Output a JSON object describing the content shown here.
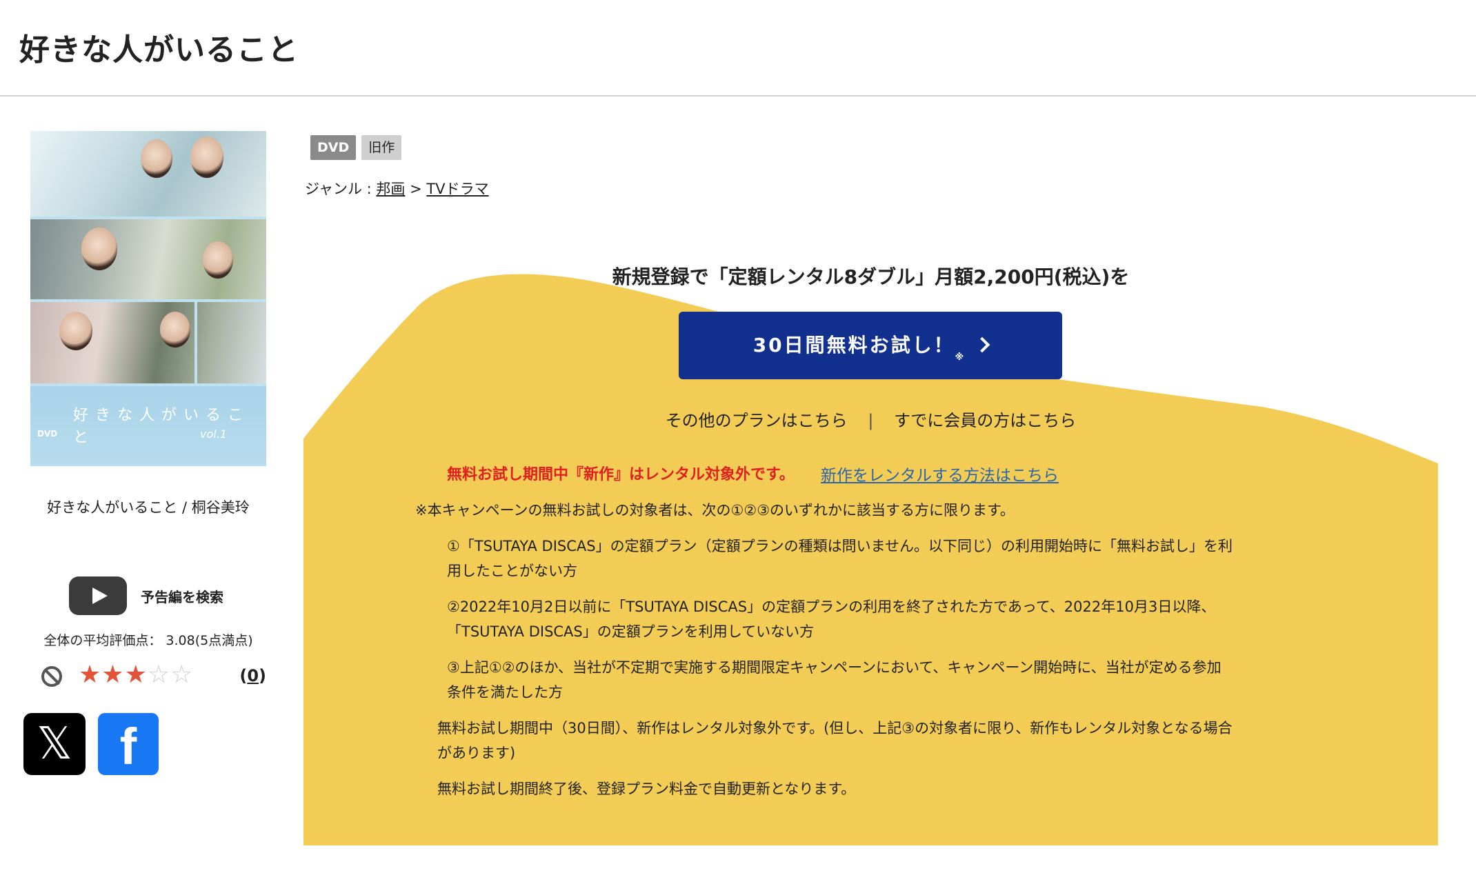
{
  "page": {
    "title": "好きな人がいること"
  },
  "product": {
    "cover_title": "好きな人がいること",
    "cover_vol": "vol.1",
    "cover_dvd": "DVD",
    "caption": "好きな人がいること / 桐谷美玲",
    "badges": [
      "DVD",
      "旧作"
    ],
    "genre_label": "ジャンル :",
    "genre_path": [
      "邦画",
      "TVドラマ"
    ],
    "genre_sep": ">"
  },
  "trailer": {
    "label": "予告編を検索",
    "icon": "youtube-play-icon"
  },
  "rating": {
    "avg_text": "全体の平均評価点： 3.08(5点満点)",
    "stars_filled": 3,
    "stars_total": 5,
    "review_count_text": "(0)",
    "review_count": "0"
  },
  "share": {
    "x_icon": "x-logo-icon",
    "facebook_icon": "facebook-logo-icon"
  },
  "promo": {
    "heading": "新規登録で「定額レンタル8ダブル」月額2,200円(税込)を",
    "cta_label": "30日間無料お試し！",
    "cta_note": "※",
    "other_plans": "その他のプランはこちら",
    "divider": "|",
    "member_link": "すでに会員の方はこちら",
    "notice_red": "無料お試し期間中『新作』はレンタル対象外です。",
    "notice_link": "新作をレンタルする方法はこちら",
    "campaign_note": "※本キャンペーンの無料お試しの対象者は、次の①②③のいずれかに該当する方に限ります。",
    "cond1_line1": "①「TSUTAYA DISCAS」の定額プラン（定額プランの種類は問いません。以下同じ）の利用開始時に「無料お試し」を利",
    "cond1_line2": "用したことがない方",
    "cond2_line1": "②2022年10月2日以前に「TSUTAYA DISCAS」の定額プランの利用を終了された方であって、2022年10月3日以降、",
    "cond2_line2": "「TSUTAYA DISCAS」の定額プランを利用していない方",
    "cond3_line1": "③上記①②のほか、当社が不定期で実施する期間限定キャンペーンにおいて、キャンペーン開始時に、当社が定める参加",
    "cond3_line2": "条件を満たした方",
    "trial_line1": "無料お試し期間中（30日間）、新作はレンタル対象外です。(但し、上記③の対象者に限り、新作もレンタル対象となる場合",
    "trial_line2": "があります)",
    "auto_renew": "無料お試し期間終了後、登録プラン料金で自動更新となります。",
    "bg_color": "#f2cc55",
    "cta_color": "#12318e"
  }
}
